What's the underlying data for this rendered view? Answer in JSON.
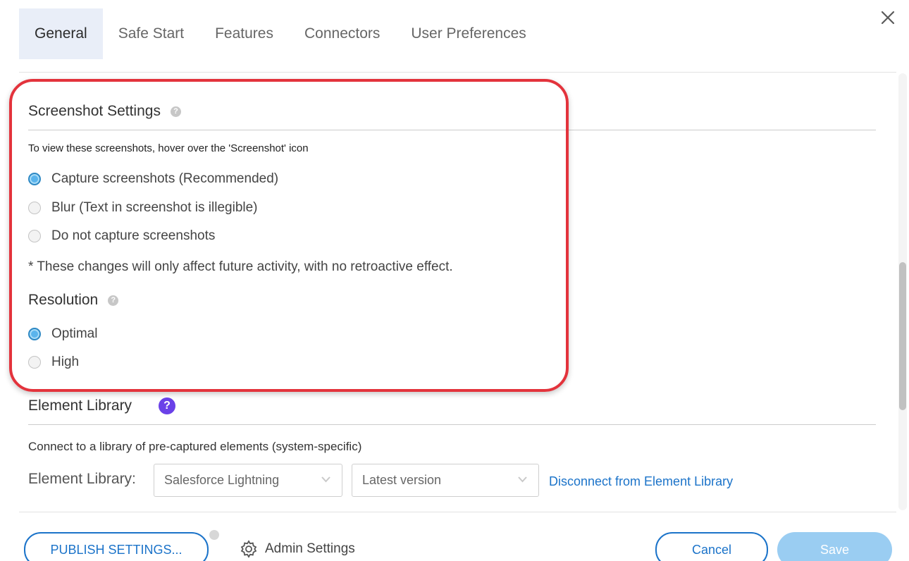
{
  "tabs": [
    {
      "label": "General",
      "active": true
    },
    {
      "label": "Safe Start",
      "active": false
    },
    {
      "label": "Features",
      "active": false
    },
    {
      "label": "Connectors",
      "active": false
    },
    {
      "label": "User Preferences",
      "active": false
    }
  ],
  "close_icon": "close-icon",
  "screenshot_settings": {
    "title": "Screenshot Settings",
    "help_icon": "question-icon",
    "description": "To view these screenshots, hover over the 'Screenshot' icon",
    "options": [
      {
        "label": "Capture screenshots (Recommended)",
        "selected": true
      },
      {
        "label": "Blur (Text in screenshot is illegible)",
        "selected": false
      },
      {
        "label": "Do not capture screenshots",
        "selected": false
      }
    ],
    "note": "* These changes will only affect future activity, with no retroactive effect."
  },
  "resolution": {
    "title": "Resolution",
    "help_icon": "question-icon",
    "options": [
      {
        "label": "Optimal",
        "selected": true
      },
      {
        "label": "High",
        "selected": false
      }
    ]
  },
  "element_library": {
    "title": "Element Library",
    "help_icon": "question-icon",
    "help_glyph": "?",
    "description": "Connect to a library of pre-captured elements (system-specific)",
    "field_label": "Element Library:",
    "system_select": "Salesforce Lightning",
    "version_select": "Latest version",
    "disconnect_link": "Disconnect from Element Library"
  },
  "footer": {
    "publish_label": "PUBLISH SETTINGS...",
    "admin_label": "Admin Settings",
    "admin_icon": "gear-icon",
    "cancel_label": "Cancel",
    "save_label": "Save"
  },
  "colors": {
    "accent": "#1b73c9",
    "highlight": "#e3333c",
    "radio_selected": "#5ab4ec",
    "save_disabled": "#9acdf2",
    "help_purple": "#6a41e8"
  }
}
